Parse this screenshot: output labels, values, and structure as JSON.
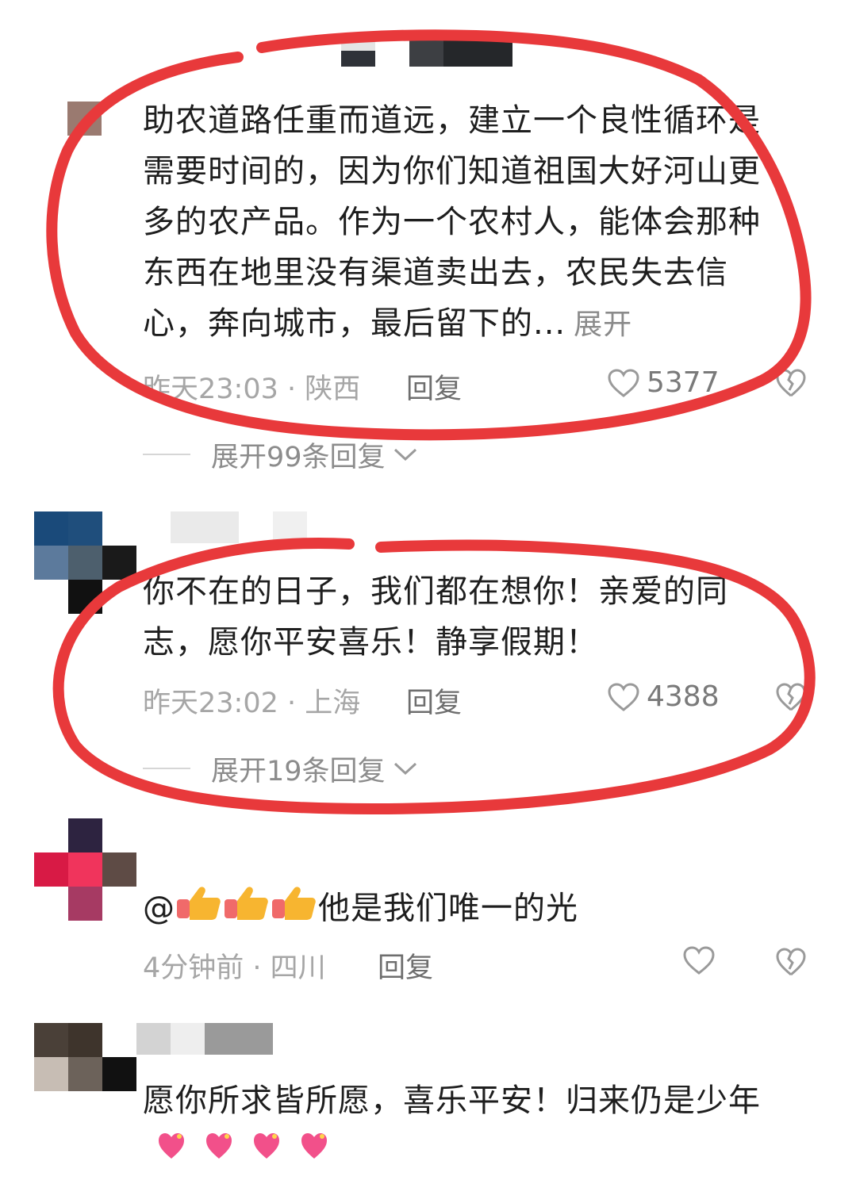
{
  "comments": [
    {
      "text": "助农道路任重而道远，建立一个良性循环是需要时间的，因为你们知道祖国大好河山更多的农产品。作为一个农村人，能体会那种东西在地里没有渠道卖出去，农民失去信心，奔向城市，最后留下的...",
      "more": "展开",
      "time_location": "昨天23:03 · 陕西",
      "reply": "回复",
      "likes": "5377",
      "expand_replies": "展开99条回复"
    },
    {
      "text": "你不在的日子，我们都在想你！亲爱的同志，愿你平安喜乐！静享假期！",
      "time_location": "昨天23:02 · 上海",
      "reply": "回复",
      "likes": "4388",
      "expand_replies": "展开19条回复"
    },
    {
      "prefix": "@",
      "text": "他是我们唯一的光",
      "emoji": [
        "thumbs-up-emoji",
        "thumbs-up-emoji",
        "thumbs-up-emoji"
      ],
      "time_location": "4分钟前 · 四川",
      "reply": "回复"
    },
    {
      "text": "愿你所求皆所愿，喜乐平安！归来仍是少年",
      "emoji": [
        "sparkling-heart-emoji",
        "sparkling-heart-emoji",
        "sparkling-heart-emoji",
        "sparkling-heart-emoji"
      ]
    }
  ],
  "icons": {
    "like": "heart-outline-icon",
    "dislike": "broken-heart-icon",
    "expand": "chevron-down-icon"
  },
  "colors": {
    "annotation_circle": "#e8393b",
    "meta_text": "#a6a6a6",
    "body_text": "#1e1e1e"
  }
}
